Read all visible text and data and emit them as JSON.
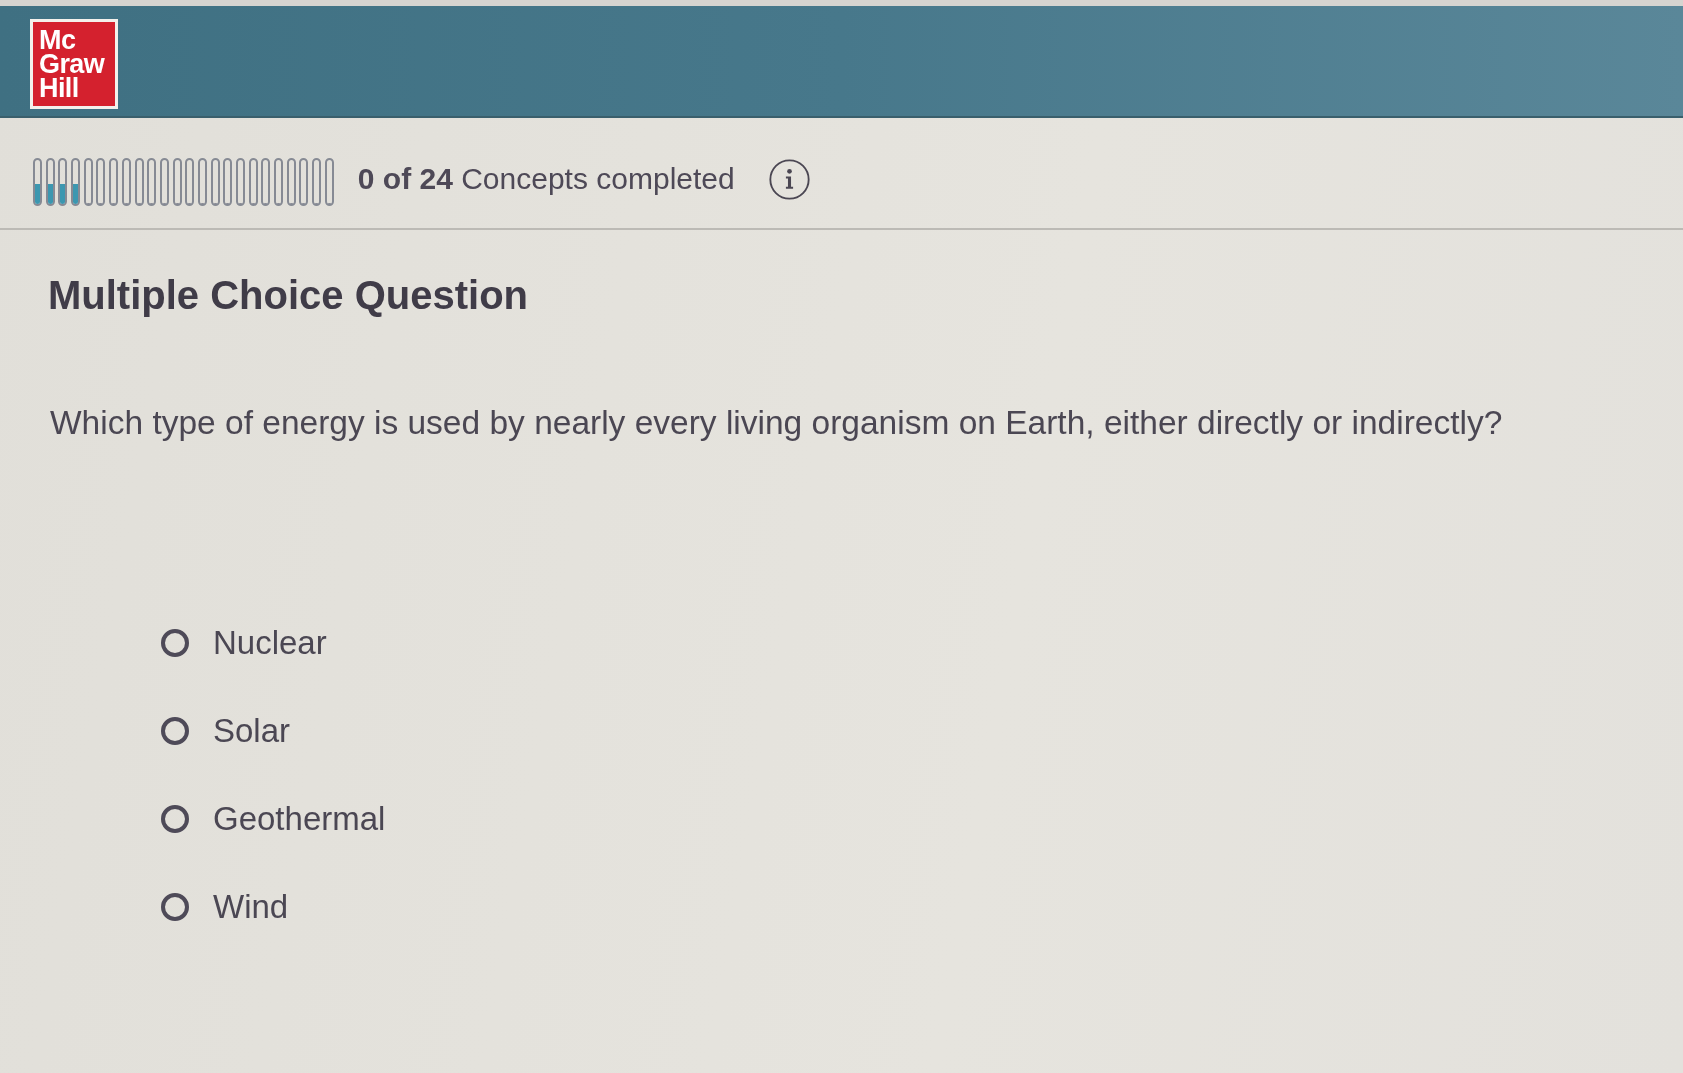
{
  "header": {
    "logo": {
      "lines": [
        "Mc",
        "Graw",
        "Hill"
      ]
    }
  },
  "progress": {
    "segments": [
      {
        "level": 0.45
      },
      {
        "level": 0.45
      },
      {
        "level": 0.45
      },
      {
        "level": 0.45
      },
      {
        "level": 0
      },
      {
        "level": 0
      },
      {
        "level": 0
      },
      {
        "level": 0
      },
      {
        "level": 0
      },
      {
        "level": 0
      },
      {
        "level": 0
      },
      {
        "level": 0
      },
      {
        "level": 0
      },
      {
        "level": 0
      },
      {
        "level": 0
      },
      {
        "level": 0
      },
      {
        "level": 0
      },
      {
        "level": 0
      },
      {
        "level": 0
      },
      {
        "level": 0
      },
      {
        "level": 0
      },
      {
        "level": 0
      },
      {
        "level": 0
      },
      {
        "level": 0
      }
    ],
    "status": "**0 of 24** Concepts completed"
  },
  "question": {
    "heading": "Multiple Choice Question",
    "prompt": "Which type of energy is used by nearly every living organism on Earth, either directly or indirectly?",
    "options": [
      {
        "label": "Nuclear",
        "selected": false
      },
      {
        "label": "Solar",
        "selected": false
      },
      {
        "label": "Geothermal",
        "selected": false
      },
      {
        "label": "Wind",
        "selected": false
      }
    ]
  }
}
